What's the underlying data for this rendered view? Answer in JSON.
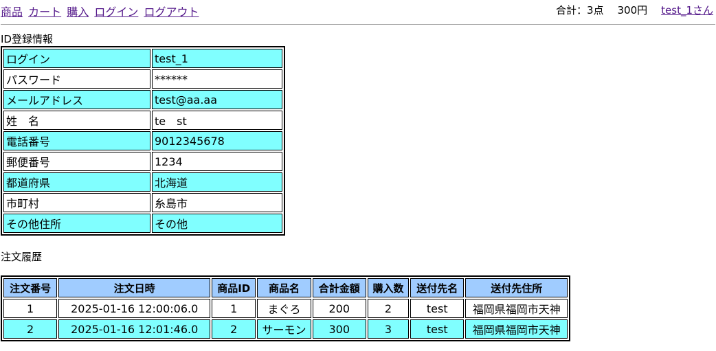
{
  "nav": {
    "links": [
      "商品",
      "カート",
      "購入",
      "ログイン",
      "ログアウト"
    ]
  },
  "summary": {
    "count": "合計：3点",
    "price": "300円",
    "user": "test_1さん"
  },
  "profile": {
    "title": "ID登録情報",
    "rows": [
      {
        "label": "ログイン",
        "value": "test_1"
      },
      {
        "label": "パスワード",
        "value": "******"
      },
      {
        "label": "メールアドレス",
        "value": "test@aa.aa"
      },
      {
        "label": "姓　名",
        "value": "te　st"
      },
      {
        "label": "電話番号",
        "value": "9012345678"
      },
      {
        "label": "郵便番号",
        "value": "1234"
      },
      {
        "label": "都道府県",
        "value": "北海道"
      },
      {
        "label": "市町村",
        "value": "糸島市"
      },
      {
        "label": "その他住所",
        "value": "その他"
      }
    ]
  },
  "orders": {
    "title": "注文履歴",
    "headers": [
      "注文番号",
      "注文日時",
      "商品ID",
      "商品名",
      "合計金額",
      "購入数",
      "送付先名",
      "送付先住所"
    ],
    "rows": [
      [
        "1",
        "2025-01-16 12:00:06.0",
        "1",
        "まぐろ",
        "200",
        "2",
        "test",
        "福岡県福岡市天神"
      ],
      [
        "2",
        "2025-01-16 12:01:46.0",
        "2",
        "サーモン",
        "300",
        "3",
        "test",
        "福岡県福岡市天神"
      ]
    ]
  },
  "colors": {
    "row_highlight": "#80ffff",
    "header_bg": "#a0ccff",
    "link": "#551a8b"
  }
}
